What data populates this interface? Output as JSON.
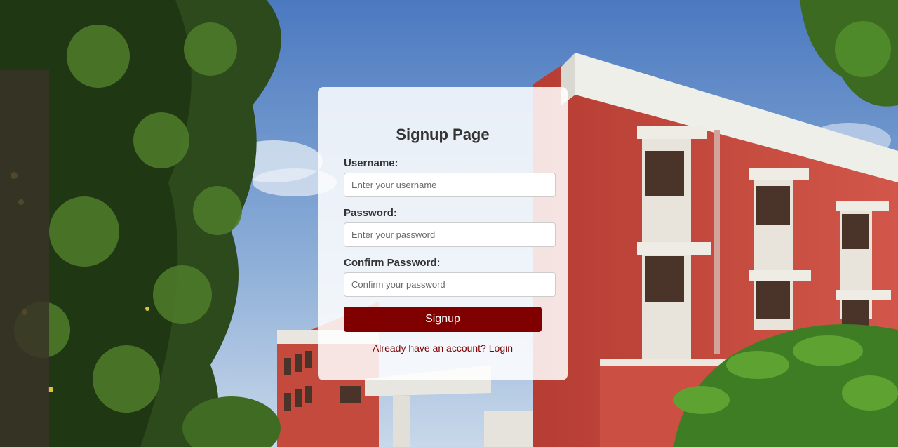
{
  "page": {
    "title": "Signup Page"
  },
  "form": {
    "username_label": "Username:",
    "username_placeholder": "Enter your username",
    "password_label": "Password:",
    "password_placeholder": "Enter your password",
    "confirm_label": "Confirm Password:",
    "confirm_placeholder": "Confirm your password",
    "submit_label": "Signup"
  },
  "footer": {
    "login_link": "Already have an account? Login"
  },
  "colors": {
    "accent": "#800000",
    "card_background": "#ffffff",
    "sky": "#5b82c0",
    "building_brick": "#c8463c",
    "foliage": "#2f4a1c"
  },
  "background": {
    "description_icon": "campus-building-photo"
  }
}
